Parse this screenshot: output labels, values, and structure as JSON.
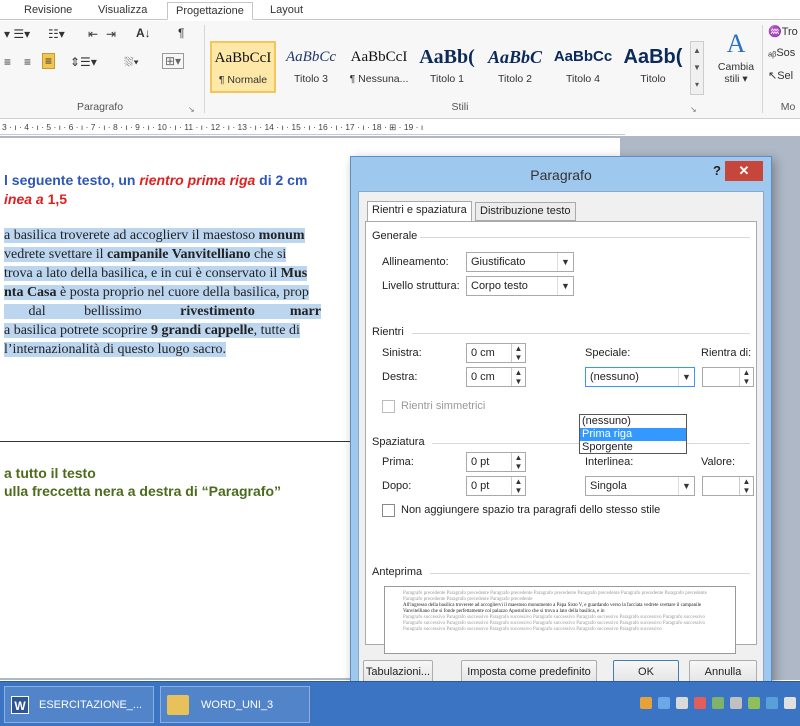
{
  "ribbon_tabs": [
    "Revisione",
    "Visualizza",
    "Progettazione",
    "Layout"
  ],
  "paragraph_group": {
    "label": "Paragrafo"
  },
  "styles_group": {
    "label": "Stili",
    "change_styles": "Cambia stili ▾",
    "items": [
      {
        "sample": "AaBbCcI",
        "name": "¶ Normale"
      },
      {
        "sample": "AaBbCc",
        "name": "Titolo 3"
      },
      {
        "sample": "AaBbCcI",
        "name": "¶ Nessuna..."
      },
      {
        "sample": "AaBb(",
        "name": "Titolo 1"
      },
      {
        "sample": "AaBbC",
        "name": "Titolo 2"
      },
      {
        "sample": "AaBbCc",
        "name": "Titolo 4"
      },
      {
        "sample": "AaBb(",
        "name": "Titolo"
      }
    ]
  },
  "editing_group": {
    "trova": "Tro",
    "sostituisci": "Sos",
    "seleziona": "Sel",
    "label": "Mo"
  },
  "ruler": "3 · ı · 4 · ı · 5 · ı · 6 · ı · 7 · ı · 8 · ı · 9 · ı · 10 · ı · 11 · ı · 12 · ı · 13 · ı · 14 · ı · 15 · ı · 16 · ı · 17 · ı · 18 · ⊞ · 19 · ı",
  "document": {
    "instr1_a": "l seguente testo, un ",
    "instr1_b": "rientro prima riga",
    "instr1_c": " di 2 cm",
    "instr2_a": "inea a ",
    "instr2_b": "1,5",
    "body_lines": [
      {
        "a": "a basilica troverete ad accoglierv il maestoso ",
        "b": "monum"
      },
      {
        "a": " vedrete svettare il ",
        "b": "campanile Vanvitelliano",
        "c": " che si"
      },
      {
        "a": " trova a lato della basilica, e in cui è conservato il ",
        "b": "Mus"
      },
      {
        "a": "nta Casa",
        "b": " è posta proprio nel cuore della basilica, prop"
      },
      {
        "a": "       dal           bellissimo           ",
        "b": "rivestimento          marr"
      },
      {
        "a": "a basilica potrete scoprire ",
        "b": "9 grandi cappelle",
        "c": ", tutte di"
      },
      {
        "a": "l’internazionalità di questo luogo sacro."
      }
    ],
    "step1": "a tutto il testo",
    "step2": "ulla freccetta nera a destra di “Paragrafo”"
  },
  "dialog": {
    "title": "Paragrafo",
    "help": "?",
    "close": "✕",
    "tabs": [
      "Rientri e spaziatura",
      "Distribuzione testo"
    ],
    "generale": {
      "section": "Generale",
      "align_label": "Allineamento:",
      "align_value": "Giustificato",
      "level_label": "Livello struttura:",
      "level_value": "Corpo testo"
    },
    "rientri": {
      "section": "Rientri",
      "left_label": "Sinistra:",
      "left_value": "0 cm",
      "right_label": "Destra:",
      "right_value": "0 cm",
      "special_label": "Speciale:",
      "special_value": "(nessuno)",
      "by_label": "Rientra di:",
      "options": [
        "(nessuno)",
        "Prima riga",
        "Sporgente"
      ],
      "selected_option": "Prima riga",
      "mirror_label": "Rientri simmetrici"
    },
    "spaziatura": {
      "section": "Spaziatura",
      "before_label": "Prima:",
      "before_value": "0 pt",
      "after_label": "Dopo:",
      "after_value": "0 pt",
      "line_label": "Interlinea:",
      "line_value": "Singola",
      "value_label": "Valore:",
      "no_space_label": "Non aggiungere spazio tra paragrafi dello stesso stile"
    },
    "preview": {
      "section": "Anteprima",
      "prev": "Paragrafo precedente Paragrafo precedente Paragrafo precedente Paragrafo precedente Paragrafo precedente Paragrafo precedente Paragrafo precedente Paragrafo precedente Paragrafo precedente Paragrafo precedente",
      "sample": "All'ingresso della basilica troverete ad accogliervi il maestoso monumento a Papa Sisto V, e guardando verso la facciata vedrete svettare il campanile Vanvitelliano che si fonde perfettamente col palazzo Apostolico che si trova a lato della basilica, e in",
      "next": "Paragrafo successivo Paragrafo successivo Paragrafo successivo Paragrafo successivo Paragrafo successivo Paragrafo successivo Paragrafo successivo Paragrafo successivo Paragrafo successivo Paragrafo successivo Paragrafo successivo Paragrafo successivo Paragrafo successivo Paragrafo successivo Paragrafo successivo Paragrafo successivo Paragrafo successivo Paragrafo successivo Paragrafo successivo Paragrafo successivo"
    },
    "buttons": {
      "tabs": "Tabulazioni...",
      "default": "Imposta come predefinito",
      "ok": "OK",
      "cancel": "Annulla"
    }
  },
  "taskbar": {
    "item1": "ESERCITAZIONE_...",
    "item2": "WORD_UNI_3"
  },
  "colors": {
    "accent": "#3b74c2",
    "highlight": "#bcd6f0",
    "instruction_blue": "#2c56b8",
    "instruction_red": "#e02020",
    "step_green": "#4d6b1d"
  }
}
